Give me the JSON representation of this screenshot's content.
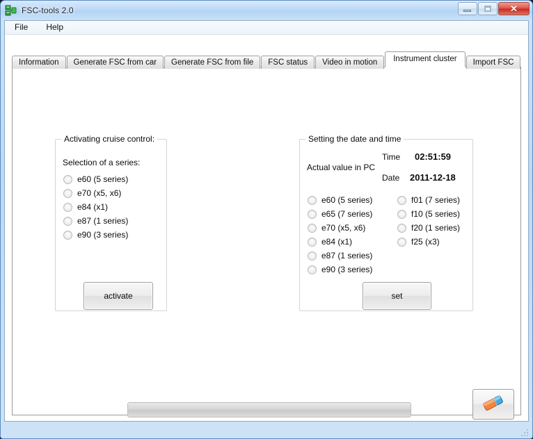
{
  "window": {
    "title": "FSC-tools 2.0",
    "icon": "app-icon",
    "controls": {
      "minimize": "minimize",
      "maximize": "maximize",
      "close": "✕"
    }
  },
  "menubar": {
    "items": [
      {
        "label": "File"
      },
      {
        "label": "Help"
      }
    ]
  },
  "tabs": [
    {
      "label": "Information",
      "active": false
    },
    {
      "label": "Generate FSC from car",
      "active": false
    },
    {
      "label": "Generate FSC from file",
      "active": false
    },
    {
      "label": "FSC status",
      "active": false
    },
    {
      "label": "Video in motion",
      "active": false
    },
    {
      "label": "Instrument cluster",
      "active": true
    },
    {
      "label": "Import FSC",
      "active": false
    }
  ],
  "cruise_group": {
    "title": "Activating cruise control:",
    "selection_label": "Selection of a series:",
    "options": [
      {
        "label": "e60 (5 series)",
        "selected": false
      },
      {
        "label": "e70 (x5, x6)",
        "selected": false
      },
      {
        "label": "e84 (x1)",
        "selected": false
      },
      {
        "label": "e87 (1 series)",
        "selected": false
      },
      {
        "label": "e90 (3 series)",
        "selected": false
      }
    ],
    "activate_button": "activate"
  },
  "datetime_group": {
    "title": "Setting the date and time",
    "actual_value_label": "Actual value in PC",
    "time_label": "Time",
    "time_value": "02:51:59",
    "date_label": "Date",
    "date_value": "2011-12-18",
    "options_col1": [
      {
        "label": "e60 (5 series)",
        "selected": false
      },
      {
        "label": "e65 (7 series)",
        "selected": false
      },
      {
        "label": "e70 (x5, x6)",
        "selected": false
      },
      {
        "label": "e84 (x1)",
        "selected": false
      },
      {
        "label": "e87 (1 series)",
        "selected": false
      },
      {
        "label": "e90 (3 series)",
        "selected": false
      }
    ],
    "options_col2": [
      {
        "label": "f01 (7 series)",
        "selected": false
      },
      {
        "label": "f10 (5 series)",
        "selected": false
      },
      {
        "label": "f20 (1 series)",
        "selected": false
      },
      {
        "label": "f25 (x3)",
        "selected": false
      }
    ],
    "set_button": "set"
  },
  "progress": {
    "value": 0,
    "percent_text": ""
  },
  "eraser_button": {
    "icon": "eraser-icon",
    "tooltip": ""
  },
  "colors": {
    "titlebar_from": "#d9eafc",
    "titlebar_to": "#cbe2fa",
    "close_button": "#c32e22",
    "eraser_orange": "#f0781e",
    "eraser_blue": "#3b9ede",
    "window_border": "#5b8cc0",
    "panel_background": "#ffffff"
  }
}
